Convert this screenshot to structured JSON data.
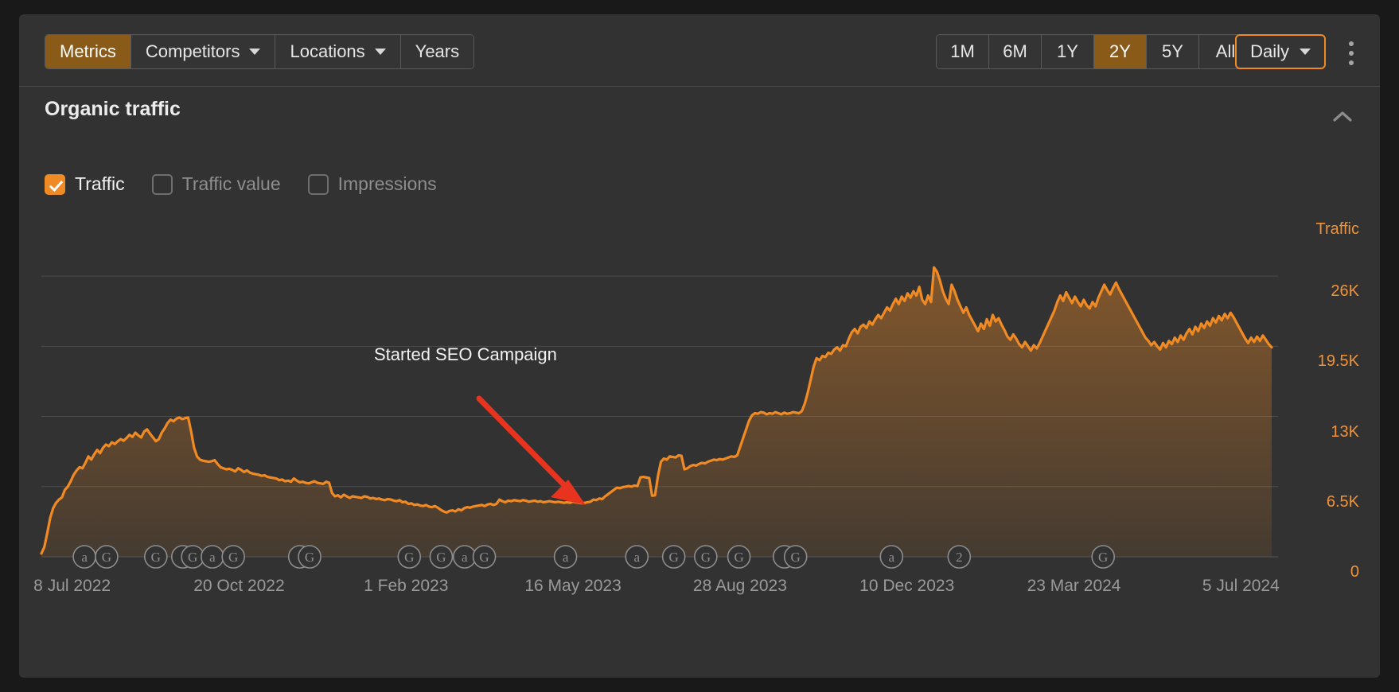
{
  "toolbar": {
    "tabs": [
      {
        "label": "Metrics",
        "active": true,
        "caret": false
      },
      {
        "label": "Competitors",
        "active": false,
        "caret": true
      },
      {
        "label": "Locations",
        "active": false,
        "caret": true
      },
      {
        "label": "Years",
        "active": false,
        "caret": false
      }
    ],
    "ranges": [
      {
        "label": "1M",
        "active": false
      },
      {
        "label": "6M",
        "active": false
      },
      {
        "label": "1Y",
        "active": false
      },
      {
        "label": "2Y",
        "active": true
      },
      {
        "label": "5Y",
        "active": false
      },
      {
        "label": "All",
        "active": false
      }
    ],
    "granularity_label": "Daily",
    "more_icon": "kebab-menu-icon"
  },
  "section": {
    "title": "Organic traffic",
    "collapse_icon": "chevron-up-icon",
    "checkboxes": [
      {
        "label": "Traffic",
        "checked": true
      },
      {
        "label": "Traffic value",
        "checked": false
      },
      {
        "label": "Impressions",
        "checked": false
      }
    ]
  },
  "annotation": {
    "text": "Started SEO Campaign",
    "color": "#e8341f"
  },
  "colors": {
    "accent": "#f08a24",
    "active_tab": "#8a5a19",
    "panel_bg": "#323232",
    "grid": "#4c4c4c"
  },
  "chart_data": {
    "type": "area",
    "title": "Organic traffic",
    "series_name": "Traffic",
    "legend_label": "Traffic",
    "legend_position": "top-right",
    "grid": true,
    "xlabel": "",
    "ylabel": "Traffic",
    "ylim": [
      0,
      29250
    ],
    "ytick_labels": [
      "26K",
      "19.5K",
      "13K",
      "6.5K",
      "0"
    ],
    "ytick_values": [
      26000,
      19500,
      13000,
      6500,
      0
    ],
    "xtick_labels": [
      "8 Jul 2022",
      "20 Oct 2022",
      "1 Feb 2023",
      "16 May 2023",
      "28 Aug 2023",
      "10 Dec 2023",
      "23 Mar 2024",
      "5 Jul 2024"
    ],
    "x_markers": [
      {
        "x_frac": 0.035,
        "glyph": "a"
      },
      {
        "x_frac": 0.053,
        "glyph": "G"
      },
      {
        "x_frac": 0.093,
        "glyph": "G"
      },
      {
        "x_frac": 0.115,
        "glyph": "C"
      },
      {
        "x_frac": 0.123,
        "glyph": "G"
      },
      {
        "x_frac": 0.139,
        "glyph": "a"
      },
      {
        "x_frac": 0.156,
        "glyph": "G"
      },
      {
        "x_frac": 0.21,
        "glyph": "C"
      },
      {
        "x_frac": 0.218,
        "glyph": "G"
      },
      {
        "x_frac": 0.299,
        "glyph": "G"
      },
      {
        "x_frac": 0.325,
        "glyph": "G"
      },
      {
        "x_frac": 0.344,
        "glyph": "a"
      },
      {
        "x_frac": 0.36,
        "glyph": "G"
      },
      {
        "x_frac": 0.426,
        "glyph": "a"
      },
      {
        "x_frac": 0.484,
        "glyph": "a"
      },
      {
        "x_frac": 0.514,
        "glyph": "G"
      },
      {
        "x_frac": 0.54,
        "glyph": "G"
      },
      {
        "x_frac": 0.567,
        "glyph": "G"
      },
      {
        "x_frac": 0.604,
        "glyph": "C"
      },
      {
        "x_frac": 0.613,
        "glyph": "G"
      },
      {
        "x_frac": 0.691,
        "glyph": "a"
      },
      {
        "x_frac": 0.746,
        "glyph": "2"
      },
      {
        "x_frac": 0.863,
        "glyph": "G"
      }
    ],
    "values": [
      300,
      900,
      2200,
      3600,
      4500,
      5000,
      5300,
      5500,
      6200,
      6500,
      7000,
      7600,
      8000,
      8300,
      8200,
      8700,
      9300,
      9000,
      9500,
      9900,
      9600,
      10100,
      10400,
      10250,
      10600,
      10450,
      10700,
      10900,
      10750,
      11000,
      11300,
      11100,
      11500,
      11250,
      11050,
      11600,
      11800,
      11400,
      11050,
      10700,
      10900,
      11500,
      11900,
      12400,
      12700,
      12550,
      12800,
      12900,
      12750,
      12850,
      12900,
      11600,
      10100,
      9300,
      9000,
      8900,
      8850,
      8800,
      8850,
      8950,
      8600,
      8300,
      8200,
      8100,
      8150,
      8050,
      7900,
      8200,
      8050,
      7850,
      8000,
      7800,
      7700,
      7650,
      7600,
      7500,
      7550,
      7400,
      7350,
      7300,
      7250,
      7100,
      7150,
      7000,
      7050,
      6950,
      7250,
      7050,
      6900,
      6950,
      6850,
      6800,
      6900,
      7000,
      6850,
      6800,
      6750,
      6950,
      6850,
      5900,
      5600,
      5700,
      5500,
      5750,
      5600,
      5450,
      5600,
      5550,
      5500,
      5450,
      5600,
      5550,
      5400,
      5450,
      5350,
      5400,
      5300,
      5250,
      5350,
      5300,
      5200,
      5150,
      5250,
      5050,
      5100,
      4900,
      4950,
      4800,
      4850,
      4750,
      4700,
      4800,
      4650,
      4600,
      4700,
      4550,
      4350,
      4200,
      4100,
      4250,
      4300,
      4200,
      4400,
      4300,
      4500,
      4600,
      4550,
      4650,
      4700,
      4750,
      4800,
      4700,
      4850,
      4900,
      4800,
      4900,
      5300,
      5150,
      5050,
      5200,
      5150,
      5250,
      5200,
      5150,
      5250,
      5200,
      5100,
      5150,
      5200,
      5100,
      5150,
      5050,
      5100,
      5150,
      5100,
      5050,
      5100,
      5050,
      5000,
      5050,
      5000,
      5100,
      5050,
      5000,
      4950,
      5000,
      5050,
      5100,
      5300,
      5250,
      5400,
      5350,
      5600,
      5800,
      6000,
      6200,
      6400,
      6350,
      6450,
      6500,
      6550,
      6500,
      6600,
      6550,
      7350,
      7400,
      7350,
      7300,
      5650,
      5700,
      7500,
      8800,
      9100,
      9000,
      9300,
      9250,
      9200,
      9400,
      9350,
      8100,
      8200,
      8400,
      8500,
      8450,
      8600,
      8700,
      8650,
      8800,
      8900,
      9000,
      8950,
      9050,
      9000,
      9100,
      9200,
      9300,
      9250,
      9400,
      10200,
      11000,
      11800,
      12600,
      13100,
      13300,
      13250,
      13400,
      13350,
      13200,
      13300,
      13250,
      13400,
      13300,
      13200,
      13350,
      13250,
      13300,
      13400,
      13350,
      13300,
      13500,
      14200,
      15200,
      16400,
      17600,
      18400,
      18200,
      18600,
      18500,
      18900,
      18800,
      19200,
      19400,
      19100,
      19600,
      19500,
      20200,
      20800,
      21100,
      20700,
      21300,
      21500,
      21200,
      21800,
      21500,
      22000,
      22400,
      22100,
      22600,
      23100,
      22800,
      23400,
      23900,
      23400,
      24100,
      23700,
      24400,
      24000,
      24600,
      24200,
      25000,
      23800,
      23400,
      24200,
      23600,
      26800,
      26400,
      25600,
      24600,
      23900,
      23400,
      25200,
      24600,
      23800,
      23200,
      22600,
      23100,
      22400,
      21900,
      21400,
      20900,
      21600,
      21100,
      22000,
      21400,
      22400,
      21800,
      22100,
      21500,
      21000,
      20400,
      20100,
      20600,
      20200,
      19700,
      19400,
      19900,
      19500,
      19100,
      19600,
      19300,
      19800,
      20400,
      21000,
      21600,
      22200,
      22800,
      23600,
      24200,
      23700,
      24500,
      24000,
      23500,
      24100,
      23600,
      23200,
      23800,
      23300,
      23000,
      23600,
      23200,
      24000,
      24600,
      25200,
      24700,
      24300,
      24900,
      25400,
      24800,
      24300,
      23800,
      23300,
      22800,
      22300,
      21800,
      21300,
      20800,
      20300,
      20000,
      19600,
      19900,
      19500,
      19200,
      19800,
      19400,
      20000,
      19700,
      20300,
      19900,
      20500,
      20100,
      20700,
      21100,
      20600,
      21300,
      20900,
      21600,
      21200,
      21800,
      21400,
      22100,
      21700,
      22300,
      21900,
      22500,
      22100,
      22600,
      22200,
      21700,
      21200,
      20700,
      20200,
      19800,
      20300,
      19900,
      20400,
      20000,
      20500,
      20100,
      19700,
      19400
    ]
  }
}
